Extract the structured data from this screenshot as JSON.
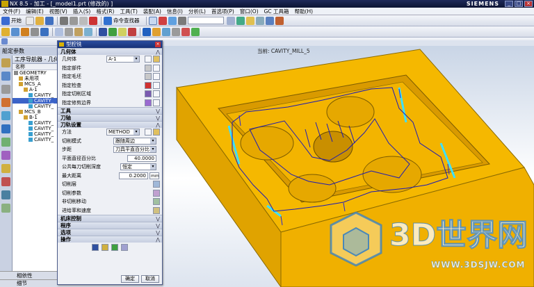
{
  "titlebar": {
    "title": "NX 8.5 - 加工 - [_model1.prt  (修改的) ]",
    "brand": "SIEMENS"
  },
  "menu": [
    "文件(F)",
    "编辑(E)",
    "视图(V)",
    "插入(S)",
    "格式(R)",
    "工具(T)",
    "装配(A)",
    "信息(I)",
    "分析(L)",
    "首选项(P)",
    "窗口(O)",
    "GC 工具箱",
    "帮助(H)"
  ],
  "toolbar": {
    "start_label": "开始",
    "command_finder": "命令查找器"
  },
  "navigator": {
    "panel_title": "船定参数",
    "header": "工序导航器 - 几何",
    "column": "名称",
    "nodes": [
      {
        "label": "GEOMETRY",
        "indent": 0
      },
      {
        "label": "未用项",
        "indent": 1
      },
      {
        "label": "MCS_A",
        "indent": 1
      },
      {
        "label": "A-1",
        "indent": 2
      },
      {
        "label": "CAVITY_",
        "indent": 3
      },
      {
        "label": "CAVITY_",
        "indent": 3,
        "selected": true
      },
      {
        "label": "CAVITY_",
        "indent": 3
      },
      {
        "label": "MCS_B",
        "indent": 1
      },
      {
        "label": "B-1",
        "indent": 2
      },
      {
        "label": "CAVITY_",
        "indent": 3
      },
      {
        "label": "CAVITY_",
        "indent": 3
      },
      {
        "label": "CAVITY_",
        "indent": 3
      },
      {
        "label": "CAVITY_",
        "indent": 3
      }
    ],
    "depends": "相依性",
    "details": "细节"
  },
  "dialog": {
    "title": "型腔铣",
    "geometry_section": "几何体",
    "geometry_label": "几何体",
    "geometry_value": "A-1",
    "geo_rows": [
      "指定部件",
      "指定毛坯",
      "指定检查",
      "指定切削区域",
      "指定修剪边界"
    ],
    "tool_section": "工具",
    "axis_section": "刀轴",
    "path_section": "刀轨设置",
    "method_label": "方法",
    "method_value": "METHOD",
    "cut_mode_label": "切削模式",
    "cut_mode_value": "跟随周边",
    "stepover_label": "步距",
    "stepover_value": "刀具平直百分比",
    "percent_label": "平面直径百分比",
    "percent_value": "40.0000",
    "depth_label": "公共每刀切削深度",
    "depth_value": "恒定",
    "max_dist_label": "最大距离",
    "max_dist_value": "0.2000",
    "max_dist_unit": "mm",
    "layer_label": "切削层",
    "params_label": "切削参数",
    "noncut_label": "非切削移动",
    "feeds_label": "进给率和速度",
    "machine_section": "机床控制",
    "program_section": "程序",
    "options_section": "选项",
    "actions_section": "操作",
    "ok_label": "确定",
    "cancel_label": "取消"
  },
  "viewport": {
    "label": "当前: CAVITY_MILL_5"
  },
  "watermark": {
    "main": "3D世界网",
    "url": "WWW.3DSJW.COM"
  },
  "colors": {
    "part": "#f5b800",
    "toolpath": "#1a1ab8",
    "background_top": "#c9d5e6"
  }
}
